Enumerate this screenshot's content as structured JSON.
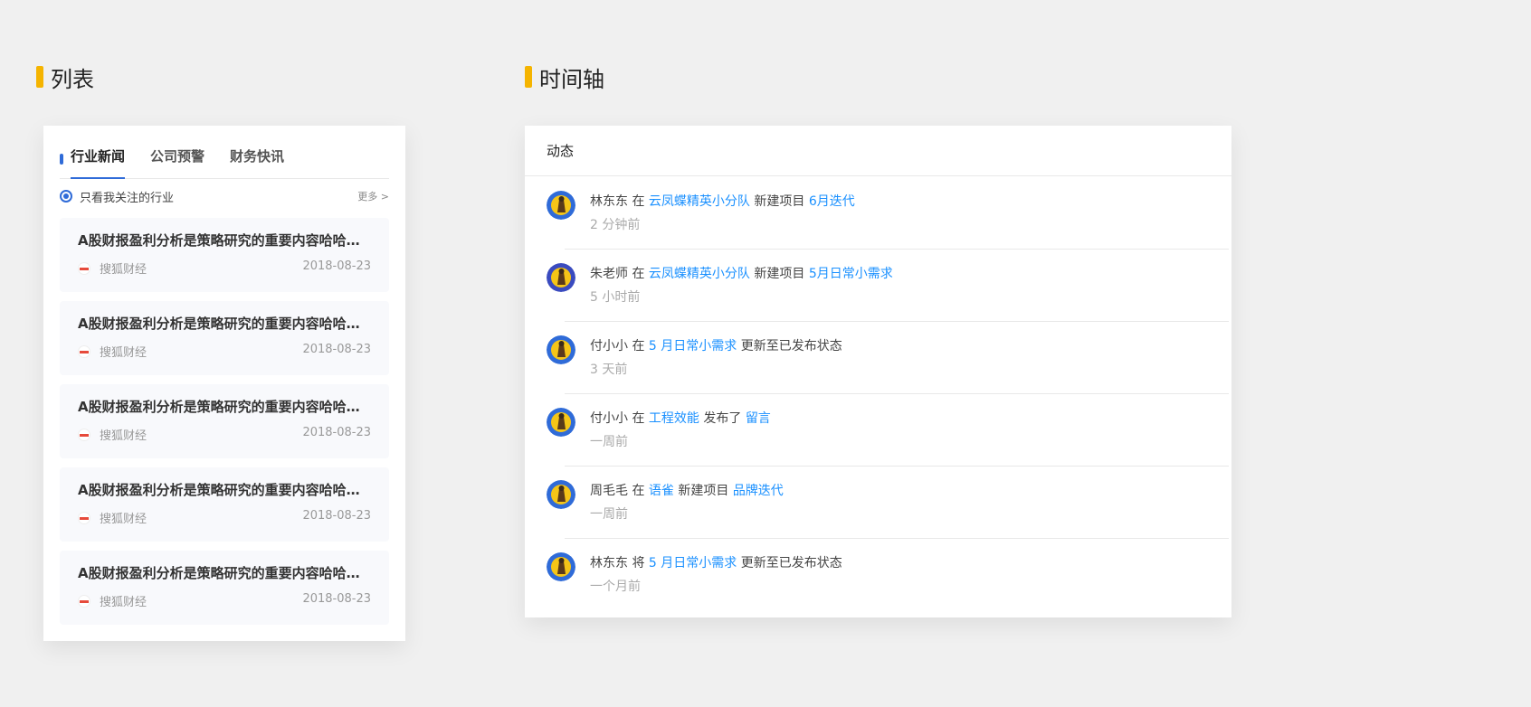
{
  "sections": {
    "list_title": "列表",
    "timeline_title": "时间轴"
  },
  "list": {
    "tabs": [
      "行业新闻",
      "公司预警",
      "财务快讯"
    ],
    "active_tab": "行业新闻",
    "filter_label": "只看我关注的行业",
    "more_label": "更多 >",
    "items": [
      {
        "title": "A股财报盈利分析是策略研究的重要内容哈哈哈哈",
        "source": "搜狐财经",
        "date": "2018-08-23"
      },
      {
        "title": "A股财报盈利分析是策略研究的重要内容哈哈哈哈",
        "source": "搜狐财经",
        "date": "2018-08-23"
      },
      {
        "title": "A股财报盈利分析是策略研究的重要内容哈哈哈哈",
        "source": "搜狐财经",
        "date": "2018-08-23"
      },
      {
        "title": "A股财报盈利分析是策略研究的重要内容哈哈哈哈",
        "source": "搜狐财经",
        "date": "2018-08-23"
      },
      {
        "title": "A股财报盈利分析是策略研究的重要内容哈哈哈哈",
        "source": "搜狐财经",
        "date": "2018-08-23"
      }
    ]
  },
  "timeline": {
    "header": "动态",
    "items": [
      {
        "user": "林东东",
        "verb1": "在",
        "target": "云凤蝶精英小分队",
        "verb2": "新建项目",
        "object": "6月迭代",
        "time": "2 分钟前",
        "avatar_color": "#2f6bd8"
      },
      {
        "user": "朱老师",
        "verb1": "在",
        "target": "云凤蝶精英小分队",
        "verb2": "新建项目",
        "object": "5月日常小需求",
        "time": "5 小时前",
        "avatar_color": "#3a4bbf"
      },
      {
        "user": "付小小",
        "verb1": "在",
        "target": "5 月日常小需求",
        "verb2": "更新至已发布状态",
        "object": "",
        "time": "3 天前",
        "avatar_color": "#2f6bd8"
      },
      {
        "user": "付小小",
        "verb1": "在",
        "target": "工程效能",
        "verb2": "发布了",
        "object": "留言",
        "time": "一周前",
        "avatar_color": "#2f6bd8"
      },
      {
        "user": "周毛毛",
        "verb1": "在",
        "target": "语雀",
        "verb2": "新建项目",
        "object": "品牌迭代",
        "time": "一周前",
        "avatar_color": "#2f6bd8"
      },
      {
        "user": "林东东",
        "verb1": "将",
        "target": "5 月日常小需求",
        "verb2": "更新至已发布状态",
        "object": "",
        "time": "一个月前",
        "avatar_color": "#2f6bd8"
      }
    ]
  },
  "colors": {
    "accent": "#2f6bd8",
    "link": "#1a90ff",
    "title_mark": "#f5b400"
  }
}
